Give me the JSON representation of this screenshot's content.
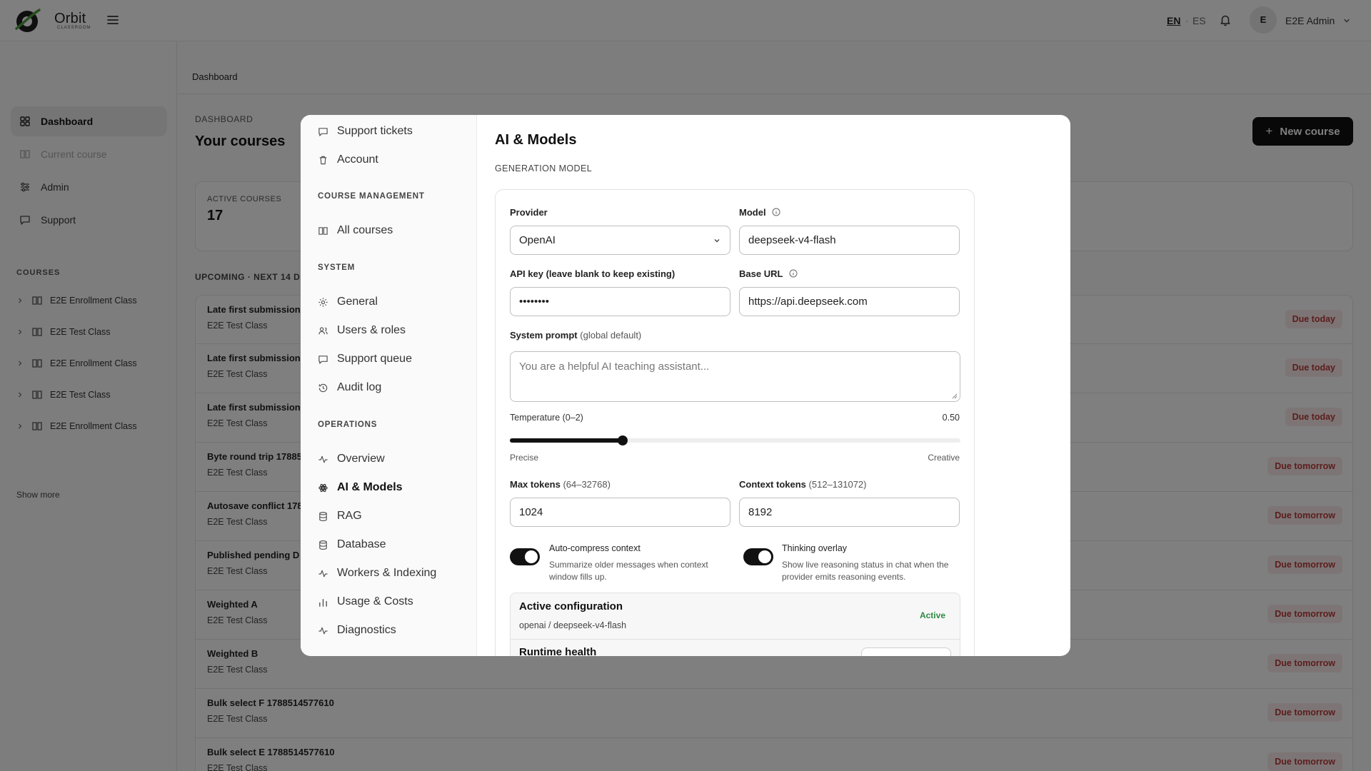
{
  "header": {
    "brand_name": "Orbit",
    "brand_sub": "CLASSROOM",
    "lang_en": "EN",
    "lang_sep": "·",
    "lang_es": "ES",
    "avatar_initial": "E",
    "user_name": "E2E Admin"
  },
  "sidebar": {
    "nav": [
      {
        "label": "Dashboard",
        "icon": "grid-icon"
      },
      {
        "label": "Current course",
        "icon": "book-icon"
      },
      {
        "label": "Admin",
        "icon": "sliders-icon"
      },
      {
        "label": "Support",
        "icon": "message-icon"
      }
    ],
    "courses_label": "COURSES",
    "courses": [
      {
        "label": "E2E Enrollment Class"
      },
      {
        "label": "E2E Test Class"
      },
      {
        "label": "E2E Enrollment Class"
      },
      {
        "label": "E2E Test Class"
      },
      {
        "label": "E2E Enrollment Class"
      }
    ],
    "show_more": "Show more"
  },
  "main": {
    "breadcrumb": "Dashboard",
    "eyebrow": "DASHBOARD",
    "title": "Your courses",
    "new_course": "New course",
    "stat_label": "ACTIVE COURSES",
    "stat_value": "17",
    "upcoming_label": "UPCOMING · NEXT 14 DA",
    "tasks": [
      {
        "title": "Late first submission",
        "course": "E2E Test Class",
        "due": "Due today"
      },
      {
        "title": "Late first submission",
        "course": "E2E Test Class",
        "due": "Due today"
      },
      {
        "title": "Late first submission",
        "course": "E2E Test Class",
        "due": "Due today"
      },
      {
        "title": "Byte round trip 17885",
        "course": "E2E Test Class",
        "due": "Due tomorrow"
      },
      {
        "title": "Autosave conflict 178",
        "course": "E2E Test Class",
        "due": "Due tomorrow"
      },
      {
        "title": "Published pending D",
        "course": "E2E Test Class",
        "due": "Due tomorrow"
      },
      {
        "title": "Weighted A",
        "course": "E2E Test Class",
        "due": "Due tomorrow"
      },
      {
        "title": "Weighted B",
        "course": "E2E Test Class",
        "due": "Due tomorrow"
      },
      {
        "title": "Bulk select F 1788514577610",
        "course": "E2E Test Class",
        "due": "Due tomorrow"
      },
      {
        "title": "Bulk select E 1788514577610",
        "course": "E2E Test Class",
        "due": "Due tomorrow"
      }
    ]
  },
  "modal": {
    "nav_top": [
      {
        "label": "Support tickets",
        "icon": "message-icon"
      },
      {
        "label": "Account",
        "icon": "trash-icon"
      }
    ],
    "course_mgmt_label": "COURSE MANAGEMENT",
    "course_mgmt": [
      {
        "label": "All courses",
        "icon": "book-icon"
      }
    ],
    "system_label": "SYSTEM",
    "system": [
      {
        "label": "General",
        "icon": "gear-icon"
      },
      {
        "label": "Users & roles",
        "icon": "users-icon"
      },
      {
        "label": "Support queue",
        "icon": "message-icon"
      },
      {
        "label": "Audit log",
        "icon": "history-icon"
      }
    ],
    "operations_label": "OPERATIONS",
    "operations": [
      {
        "label": "Overview",
        "icon": "activity-icon"
      },
      {
        "label": "AI & Models",
        "icon": "atom-icon",
        "active": true
      },
      {
        "label": "RAG",
        "icon": "database-icon"
      },
      {
        "label": "Database",
        "icon": "database-icon"
      },
      {
        "label": "Workers & Indexing",
        "icon": "activity-icon"
      },
      {
        "label": "Usage & Costs",
        "icon": "bar-chart-icon"
      },
      {
        "label": "Diagnostics",
        "icon": "activity-icon"
      }
    ],
    "content": {
      "title": "AI & Models",
      "section": "GENERATION MODEL",
      "provider_label": "Provider",
      "provider_value": "OpenAI",
      "model_label": "Model",
      "model_value": "deepseek-v4-flash",
      "api_key_label": "API key (leave blank to keep existing)",
      "api_key_value": "••••••••",
      "base_url_label": "Base URL",
      "base_url_value": "https://api.deepseek.com",
      "system_prompt_label": "System prompt",
      "system_prompt_hint": "(global default)",
      "system_prompt_placeholder": "You are a helpful AI teaching assistant...",
      "temperature_label": "Temperature (0–2)",
      "temperature_value": "0.50",
      "temperature_fraction": 0.25,
      "temperature_min_label": "Precise",
      "temperature_max_label": "Creative",
      "max_tokens_label": "Max tokens",
      "max_tokens_hint": "(64–32768)",
      "max_tokens_value": "1024",
      "context_tokens_label": "Context tokens",
      "context_tokens_hint": "(512–131072)",
      "context_tokens_value": "8192",
      "auto_compress_title": "Auto-compress context",
      "auto_compress_desc": "Summarize older messages when context window fills up.",
      "auto_compress_on": true,
      "thinking_title": "Thinking overlay",
      "thinking_desc": "Show live reasoning status in chat when the provider emits reasoning events.",
      "thinking_on": true,
      "active_config_title": "Active configuration",
      "active_config_sub": "openai / deepseek-v4-flash",
      "active_badge": "Active",
      "runtime_health_title": "Runtime health"
    }
  }
}
